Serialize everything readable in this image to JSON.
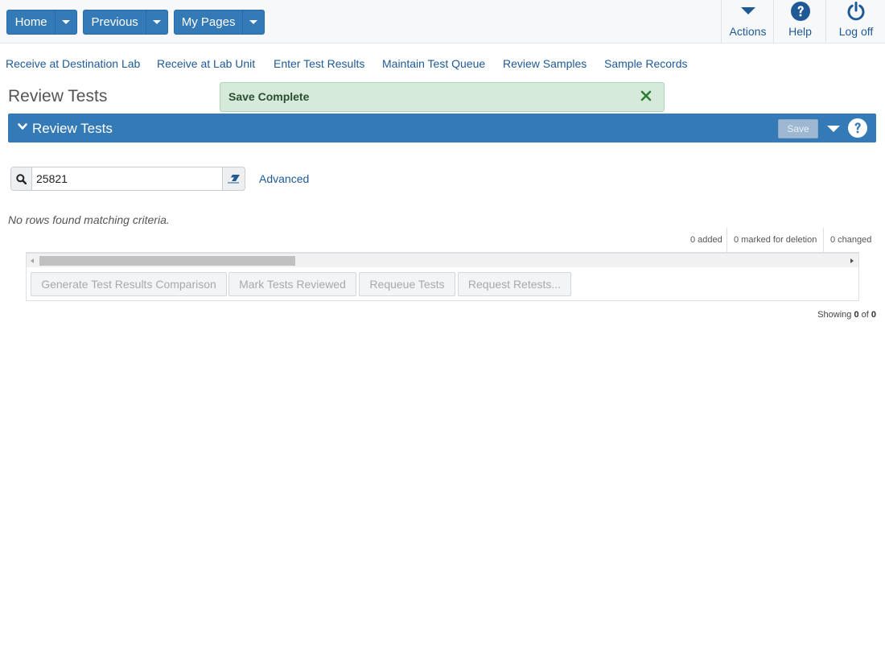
{
  "topbar": {
    "home_label": "Home",
    "previous_label": "Previous",
    "mypages_label": "My Pages",
    "actions_label": "Actions",
    "help_label": "Help",
    "logoff_label": "Log off"
  },
  "nav_links": [
    "Receive at Destination Lab",
    "Receive at Lab Unit",
    "Enter Test Results",
    "Maintain Test Queue",
    "Review Samples",
    "Sample Records"
  ],
  "page": {
    "title": "Review Tests"
  },
  "toast": {
    "message": "Save Complete"
  },
  "panel": {
    "title": "Review Tests",
    "save_label": "Save"
  },
  "search": {
    "value": "25821",
    "advanced_label": "Advanced"
  },
  "grid": {
    "empty_message": "No rows found matching criteria.",
    "added": "0 added",
    "marked_for_deletion": "0 marked for deletion",
    "changed": "0 changed",
    "buttons": {
      "generate": "Generate Test Results Comparison",
      "mark_reviewed": "Mark Tests Reviewed",
      "requeue": "Requeue Tests",
      "request_retests": "Request Retests..."
    },
    "showing_prefix": "Showing",
    "showing_from": "0",
    "showing_of": "of",
    "showing_total": "0"
  },
  "colors": {
    "primary": "#337ab7",
    "link": "#1f5a96",
    "toast_bg": "#d6eadc",
    "toast_icon": "#2e7d32"
  },
  "icons": {
    "actions": "caret-down-icon",
    "help": "question-circle-icon",
    "logoff": "power-icon",
    "toast_close": "close-icon",
    "search": "search-icon",
    "clear": "eraser-icon"
  }
}
